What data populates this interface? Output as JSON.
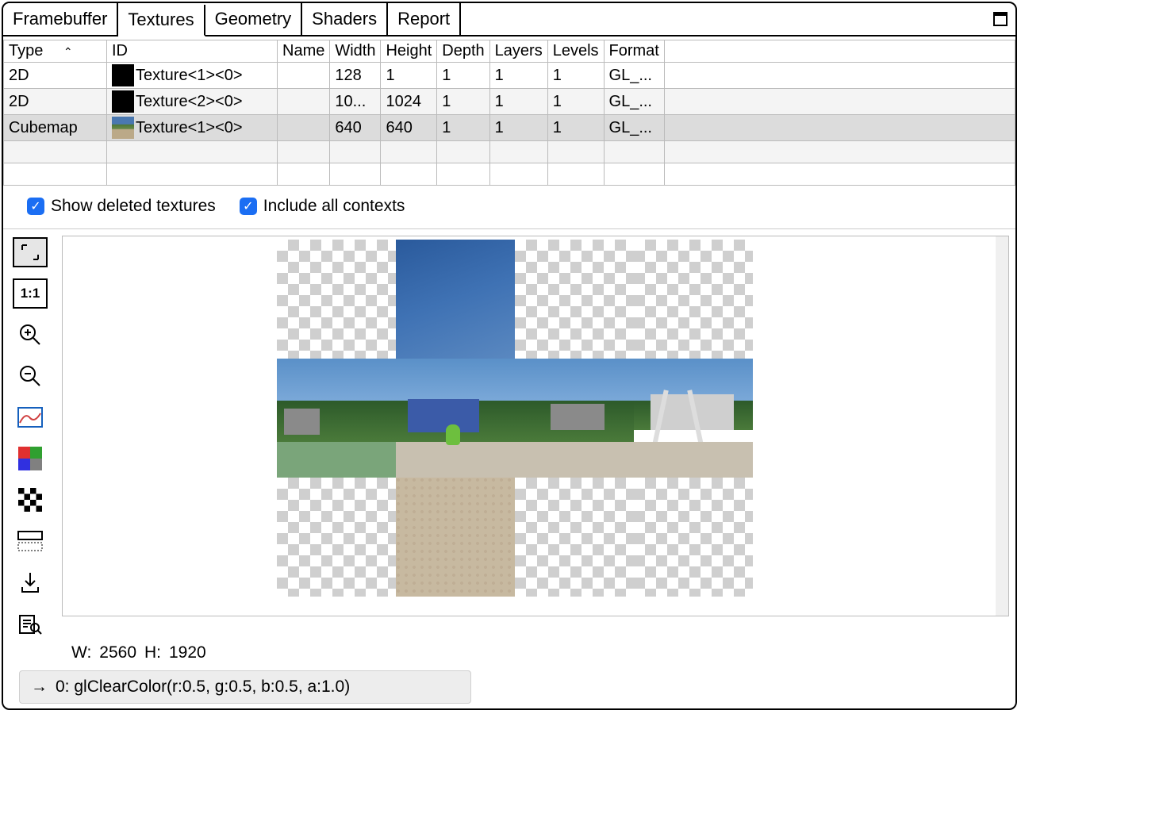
{
  "tabs": {
    "items": [
      "Framebuffer",
      "Textures",
      "Geometry",
      "Shaders",
      "Report"
    ],
    "active": 1
  },
  "columns": [
    "Type",
    "ID",
    "Name",
    "Width",
    "Height",
    "Depth",
    "Layers",
    "Levels",
    "Format"
  ],
  "sort_column": "Type",
  "rows": [
    {
      "type": "2D",
      "id": "Texture<1><0>",
      "name": "",
      "width": "128",
      "height": "1",
      "depth": "1",
      "layers": "1",
      "levels": "1",
      "format": "GL_...",
      "thumb": "black"
    },
    {
      "type": "2D",
      "id": "Texture<2><0>",
      "name": "",
      "width": "10...",
      "height": "1024",
      "depth": "1",
      "layers": "1",
      "levels": "1",
      "format": "GL_...",
      "thumb": "black"
    },
    {
      "type": "Cubemap",
      "id": "Texture<1><0>",
      "name": "",
      "width": "640",
      "height": "640",
      "depth": "1",
      "layers": "1",
      "levels": "1",
      "format": "GL_...",
      "thumb": "cube"
    }
  ],
  "selected_row": 2,
  "checks": {
    "show_deleted": {
      "label": "Show deleted textures",
      "checked": true
    },
    "include_all": {
      "label": "Include all contexts",
      "checked": true
    }
  },
  "tools": [
    {
      "name": "zoom-fit",
      "active": true
    },
    {
      "name": "actual-size",
      "active": false
    },
    {
      "name": "zoom-in",
      "active": false
    },
    {
      "name": "zoom-out",
      "active": false
    },
    {
      "name": "histogram",
      "active": false
    },
    {
      "name": "color-channels",
      "active": false
    },
    {
      "name": "checker-bg",
      "active": false
    },
    {
      "name": "flip-vertical",
      "active": false
    },
    {
      "name": "save",
      "active": false
    },
    {
      "name": "inspect",
      "active": false
    }
  ],
  "preview": {
    "dims_label_w": "W:",
    "dims_label_h": "H:",
    "w": "2560",
    "h": "1920"
  },
  "status": {
    "arrow": "→",
    "text": "0: glClearColor(r:0.5, g:0.5, b:0.5, a:1.0)"
  }
}
